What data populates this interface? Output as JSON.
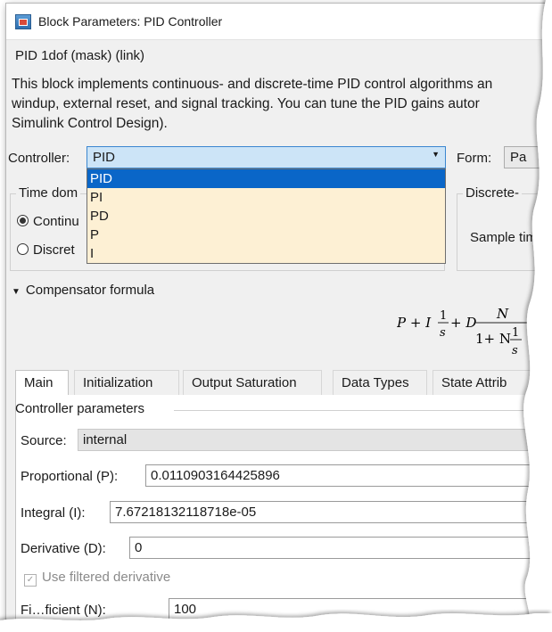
{
  "window": {
    "title": "Block Parameters: PID Controller"
  },
  "mask_label": "PID 1dof (mask) (link)",
  "description": [
    "This block implements continuous- and discrete-time PID control algorithms an",
    "windup, external reset, and signal tracking. You can tune the PID gains autor",
    "Simulink Control Design)."
  ],
  "controller": {
    "label": "Controller:",
    "value": "PID",
    "options": [
      "PID",
      "PI",
      "PD",
      "P",
      "I"
    ]
  },
  "form": {
    "label": "Form:",
    "value": "Pa"
  },
  "time_domain": {
    "title": "Time dom",
    "options": [
      "Continu",
      "Discret"
    ],
    "selected": 0
  },
  "discrete": {
    "title": "Discrete-",
    "sample_label": "Sample time"
  },
  "compensator": {
    "label": "Compensator formula",
    "formula": "P + I (1/s) + D N/(1 + N (1/s))"
  },
  "tabs": [
    "Main",
    "Initialization",
    "Output Saturation",
    "Data Types",
    "State Attrib"
  ],
  "active_tab": "Main",
  "controller_parameters": {
    "title": "Controller parameters",
    "source": {
      "label": "Source:",
      "value": "internal"
    },
    "proportional": {
      "label": "Proportional (P):",
      "value": "0.0110903164425896"
    },
    "integral": {
      "label": "Integral (I):",
      "value": "7.67218132118718e-05"
    },
    "derivative": {
      "label": "Derivative (D):",
      "value": "0"
    },
    "filtered": {
      "label": "Use filtered derivative",
      "checked": true,
      "enabled": false
    },
    "filter_coefficient": {
      "label": "Filter Coefficient (N):",
      "label_visible": "Fi…ficient (N):",
      "value": "100"
    }
  },
  "colors": {
    "selection": "#0a66c8",
    "dropdown_bg": "#fdf0d4",
    "select_bg": "#cce4f7",
    "window_bg": "#f0f0f0"
  },
  "icons": [
    "app-icon",
    "chevron-down-icon",
    "triangle-down-icon",
    "checkmark-icon"
  ]
}
